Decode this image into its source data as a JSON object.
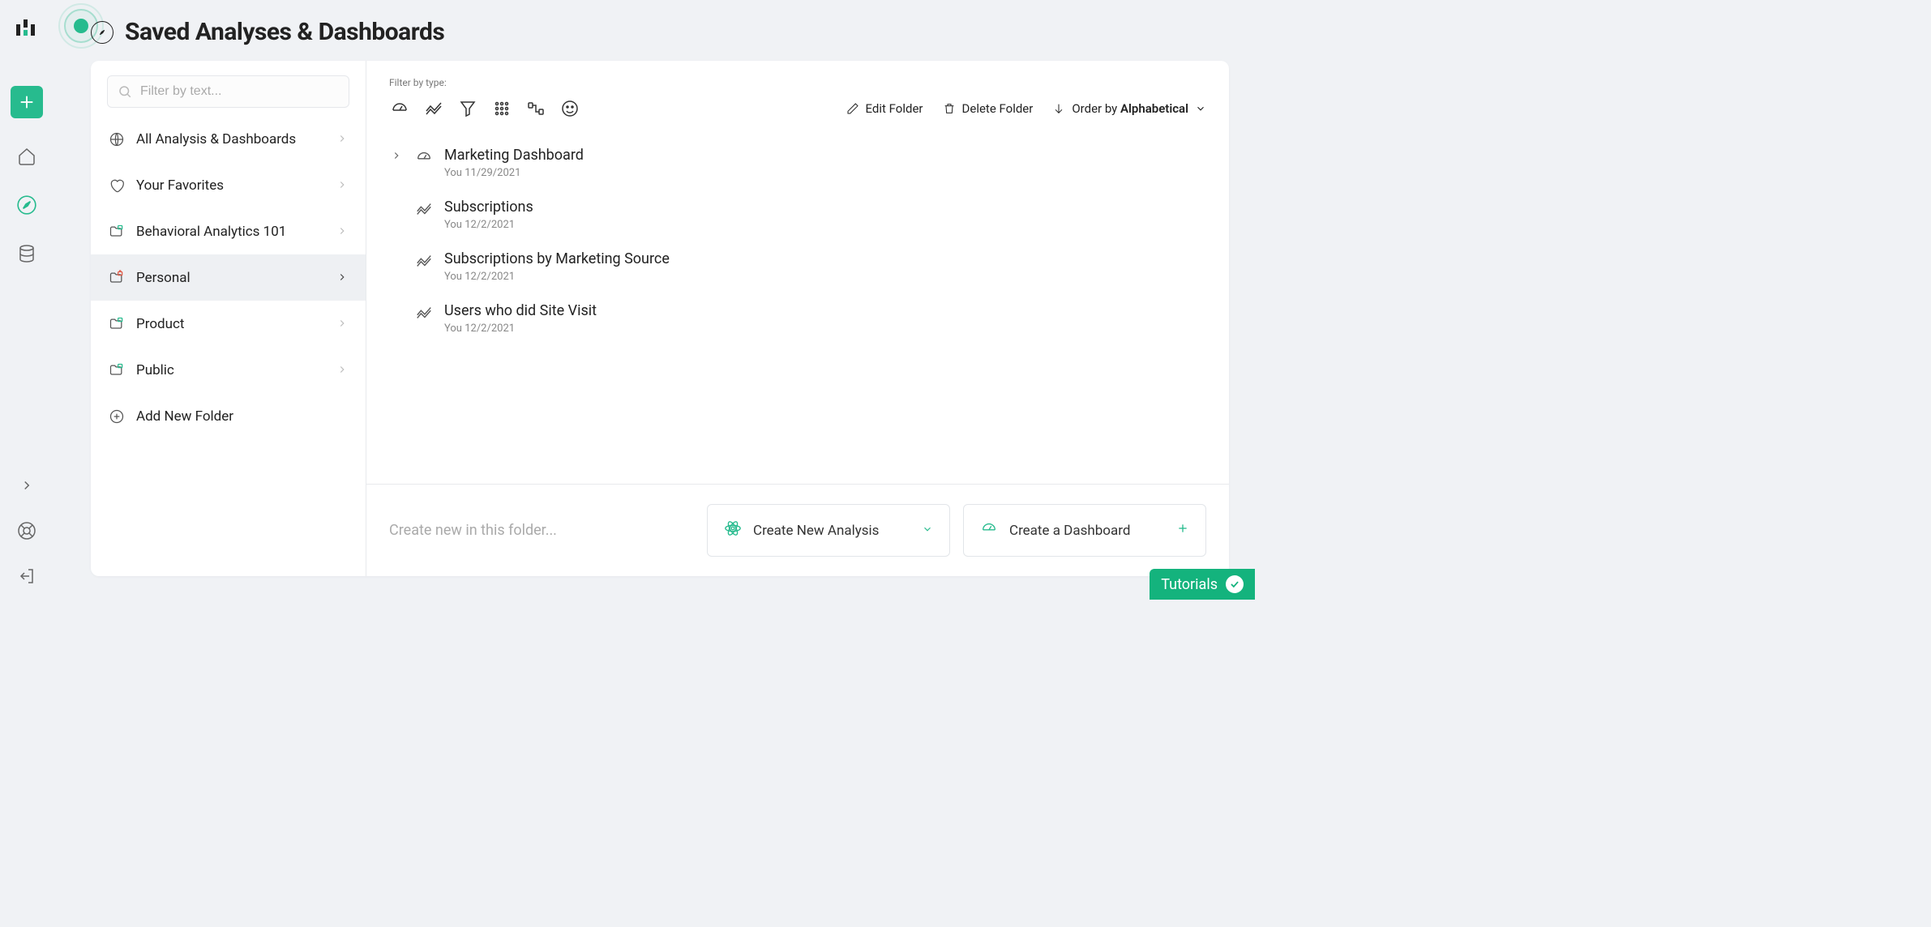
{
  "page": {
    "title": "Saved Analyses & Dashboards",
    "filter_placeholder": "Filter by text...",
    "create_placeholder": "Create new in this folder...",
    "tutorials_label": "Tutorials"
  },
  "toolbar": {
    "filter_label": "Filter by type:",
    "edit_folder": "Edit Folder",
    "delete_folder": "Delete Folder",
    "order_by_prefix": "Order by ",
    "order_by_value": "Alphabetical"
  },
  "sidebar": {
    "items": [
      {
        "label": "All Analysis & Dashboards",
        "icon": "globe",
        "active": false
      },
      {
        "label": "Your Favorites",
        "icon": "heart",
        "active": false
      },
      {
        "label": "Behavioral Analytics 101",
        "icon": "folder-shared",
        "active": false
      },
      {
        "label": "Personal",
        "icon": "folder-locked",
        "active": true
      },
      {
        "label": "Product",
        "icon": "folder-shared",
        "active": false
      },
      {
        "label": "Public",
        "icon": "folder-shared",
        "active": false
      }
    ],
    "add_folder": "Add New Folder"
  },
  "items": [
    {
      "title": "Marketing Dashboard",
      "meta": "You 11/29/2021",
      "type": "dashboard",
      "expandable": true
    },
    {
      "title": "Subscriptions",
      "meta": "You 12/2/2021",
      "type": "analysis",
      "expandable": false
    },
    {
      "title": "Subscriptions by Marketing Source",
      "meta": "You 12/2/2021",
      "type": "analysis",
      "expandable": false
    },
    {
      "title": "Users who did Site Visit",
      "meta": "You 12/2/2021",
      "type": "analysis",
      "expandable": false
    }
  ],
  "buttons": {
    "create_analysis": "Create New Analysis",
    "create_dashboard": "Create a Dashboard"
  }
}
